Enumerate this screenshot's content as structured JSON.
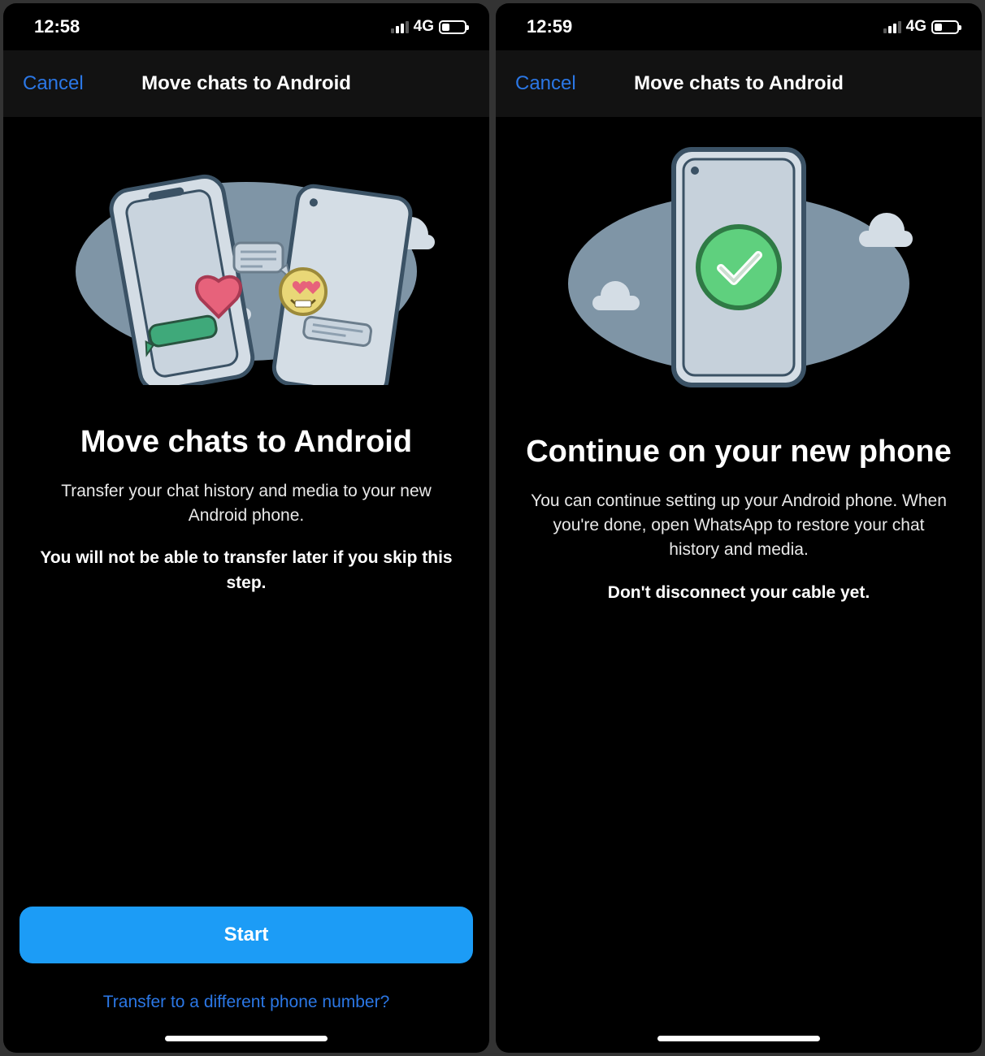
{
  "left": {
    "status": {
      "time": "12:58",
      "network": "4G"
    },
    "nav": {
      "cancel": "Cancel",
      "title": "Move chats to Android"
    },
    "heading": "Move chats to Android",
    "desc": "Transfer your chat history and media to your new Android phone.",
    "warn": "You will not be able to transfer later if you skip this step.",
    "startButton": "Start",
    "link": "Transfer to a different phone number?"
  },
  "right": {
    "status": {
      "time": "12:59",
      "network": "4G"
    },
    "nav": {
      "cancel": "Cancel",
      "title": "Move chats to Android"
    },
    "heading": "Continue on your new phone",
    "desc": "You can continue setting up your Android phone. When you're done, open WhatsApp to restore your chat history and media.",
    "warn": "Don't disconnect your cable yet."
  }
}
